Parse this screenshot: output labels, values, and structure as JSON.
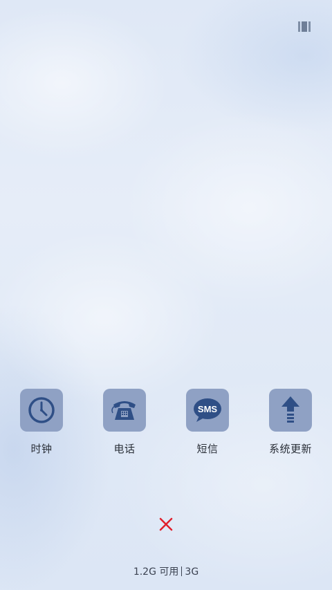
{
  "apps": [
    {
      "label": "时钟",
      "icon": "clock-icon"
    },
    {
      "label": "电话",
      "icon": "telephone-icon"
    },
    {
      "label": "短信",
      "icon": "sms-bubble-icon",
      "icon_text": "SMS"
    },
    {
      "label": "系统更新",
      "icon": "up-arrow-icon"
    }
  ],
  "memory": {
    "available": "1.2G 可用",
    "total": "3G"
  },
  "colors": {
    "icon_tile": "#8fa1c4",
    "icon_glyph": "#2f4f86",
    "close": "#e0202c"
  }
}
